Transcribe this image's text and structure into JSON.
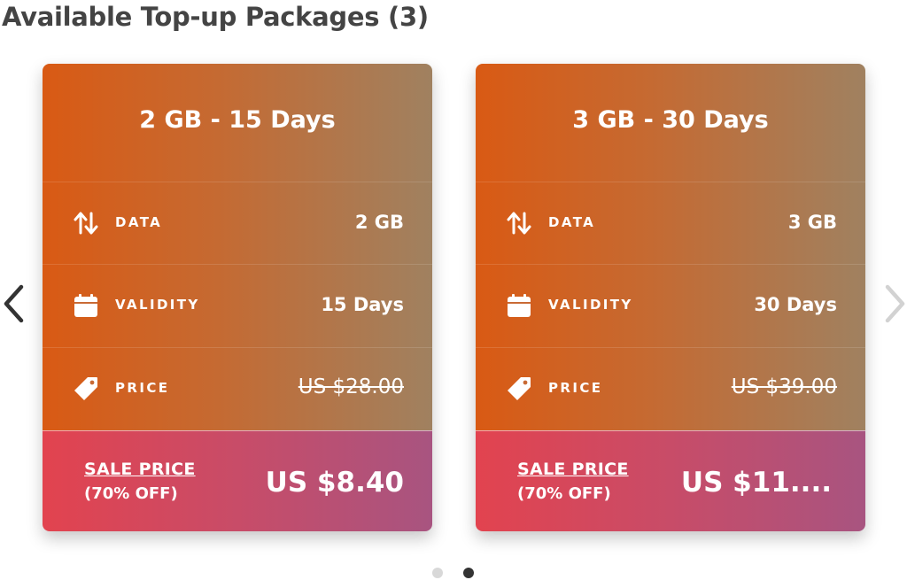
{
  "page": {
    "title": "Available Top-up Packages (3)"
  },
  "colors": {
    "card_top_start": "#d95a14",
    "card_top_end": "#a08160",
    "sale_start": "#e2434f",
    "sale_end": "#a85480",
    "title_text": "#444444",
    "dot_active": "#333333",
    "dot_inactive": "#d8d8d8"
  },
  "navigation": {
    "prev_icon": "chevron-left-icon",
    "next_icon": "chevron-right-icon",
    "next_disabled": true
  },
  "cards": [
    {
      "title": "2 GB - 15 Days",
      "rows": [
        {
          "icon": "data-transfer-icon",
          "label": "DATA",
          "value": "2 GB"
        },
        {
          "icon": "calendar-icon",
          "label": "VALIDITY",
          "value": "15 Days"
        },
        {
          "icon": "price-tag-icon",
          "label": "PRICE",
          "value": "US $28.00"
        }
      ],
      "sale": {
        "label": "SALE PRICE",
        "discount": "(70% OFF)",
        "price": "US $8.40"
      }
    },
    {
      "title": "3 GB - 30 Days",
      "rows": [
        {
          "icon": "data-transfer-icon",
          "label": "DATA",
          "value": "3 GB"
        },
        {
          "icon": "calendar-icon",
          "label": "VALIDITY",
          "value": "30 Days"
        },
        {
          "icon": "price-tag-icon",
          "label": "PRICE",
          "value": "US $39.00"
        }
      ],
      "sale": {
        "label": "SALE PRICE",
        "discount": "(70% OFF)",
        "price": "US $11...."
      }
    }
  ],
  "pagination": {
    "total": 2,
    "active": 2
  }
}
